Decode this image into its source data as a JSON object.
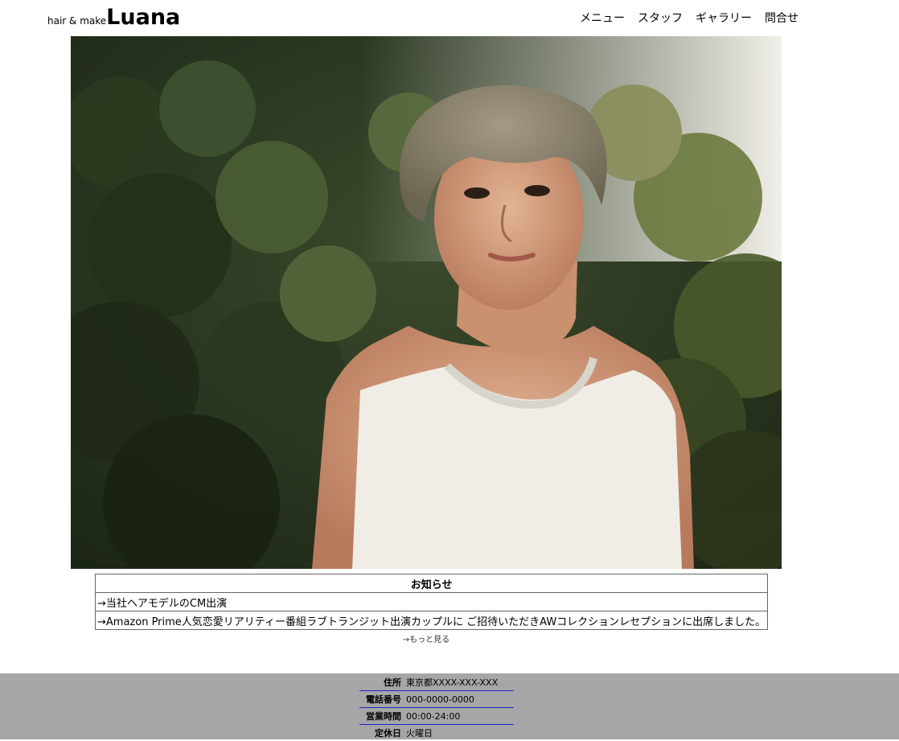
{
  "header": {
    "logo_sub": "hair & make",
    "logo_main": "Luana",
    "nav": [
      "メニュー",
      "スタッフ",
      "ギャラリー",
      "問合せ"
    ]
  },
  "hero": {
    "alt": "model-portrait"
  },
  "news": {
    "title": "お知らせ",
    "items": [
      "→当社ヘアモデルのCM出演",
      "→Amazon Prime人気恋愛リアリティー番組ラブトランジット出演カップルに ご招待いただきAWコレクションレセプションに出席しました。"
    ],
    "more": "→もっと見る"
  },
  "footer": {
    "rows": [
      {
        "label": "住所",
        "value": "東京都XXXX-XXX-XXX"
      },
      {
        "label": "電話番号",
        "value": "000-0000-0000"
      },
      {
        "label": "営業時間",
        "value": "00:00-24:00"
      },
      {
        "label": "定休日",
        "value": "火曜日"
      }
    ]
  },
  "colors": {
    "footer_bg": "#a6a6a6",
    "row_underline": "#2222cc"
  }
}
